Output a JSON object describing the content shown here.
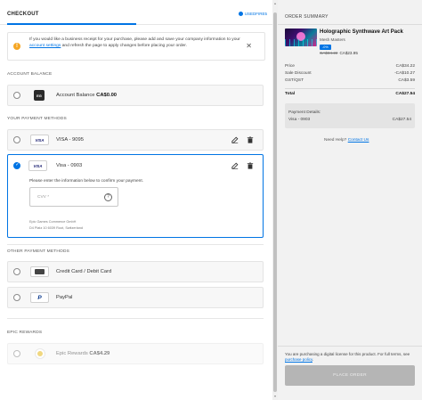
{
  "header": {
    "title": "CHECKOUT",
    "user": "USEDFIRE5"
  },
  "notice": {
    "text_before": "If you would like a business receipt for your purchase, please add and save your company information to your ",
    "link": "account settings",
    "text_after": " and refresh the page to apply changes before placing your order."
  },
  "account_balance": {
    "section": "ACCOUNT BALANCE",
    "label": "Account Balance",
    "amount": "CA$0.00"
  },
  "your_methods": {
    "section": "YOUR PAYMENT METHODS",
    "items": [
      {
        "brand": "VISA",
        "label": "VISA - 9095"
      },
      {
        "brand": "VISA",
        "label": "Visa - 0903"
      }
    ],
    "confirm_text": "Please enter the information below to confirm your payment.",
    "cvv_placeholder": "CVV *",
    "cvv_help": "?",
    "company_line1": "Epic Games Commerce GmbH",
    "company_line2": "D4 Platz 10 6039 Root, Switzerland"
  },
  "other_methods": {
    "section": "OTHER PAYMENT METHODS",
    "items": [
      {
        "label": "Credit Card / Debit Card",
        "icon": "credit-card-icon"
      },
      {
        "label": "PayPal",
        "icon": "paypal-icon"
      }
    ]
  },
  "epic_rewards": {
    "section": "EPIC REWARDS",
    "label": "Epic Rewards",
    "amount": "CA$4.29"
  },
  "summary": {
    "title": "ORDER SUMMARY",
    "product": {
      "name": "Holographic Synthwave Art Pack",
      "seller": "Mesh Masters",
      "badge": "-0%",
      "old_price": "CA$34.22",
      "new_price": "CA$23.95"
    },
    "rows": [
      {
        "label": "Price",
        "value": "CA$34.22"
      },
      {
        "label": "Sale Discount",
        "value": "-CA$10.27"
      },
      {
        "label": "GST/QST",
        "value": "CA$3.59"
      }
    ],
    "total_label": "Total",
    "total_value": "CA$27.54",
    "payment_details_label": "Payment Details:",
    "payment_method": "Visa - 0903",
    "payment_amount": "CA$27.54",
    "help_text": "Need Help?",
    "help_link": "Contact Us",
    "license_text": "You are purchasing a digital license for this product. For full terms, see ",
    "license_link": "purchase policy",
    "license_end": ".",
    "place_order": "PLACE ORDER"
  },
  "colors": {
    "accent": "#0074e4",
    "warning": "#f5a623",
    "button_disabled": "#b5b5b5"
  }
}
